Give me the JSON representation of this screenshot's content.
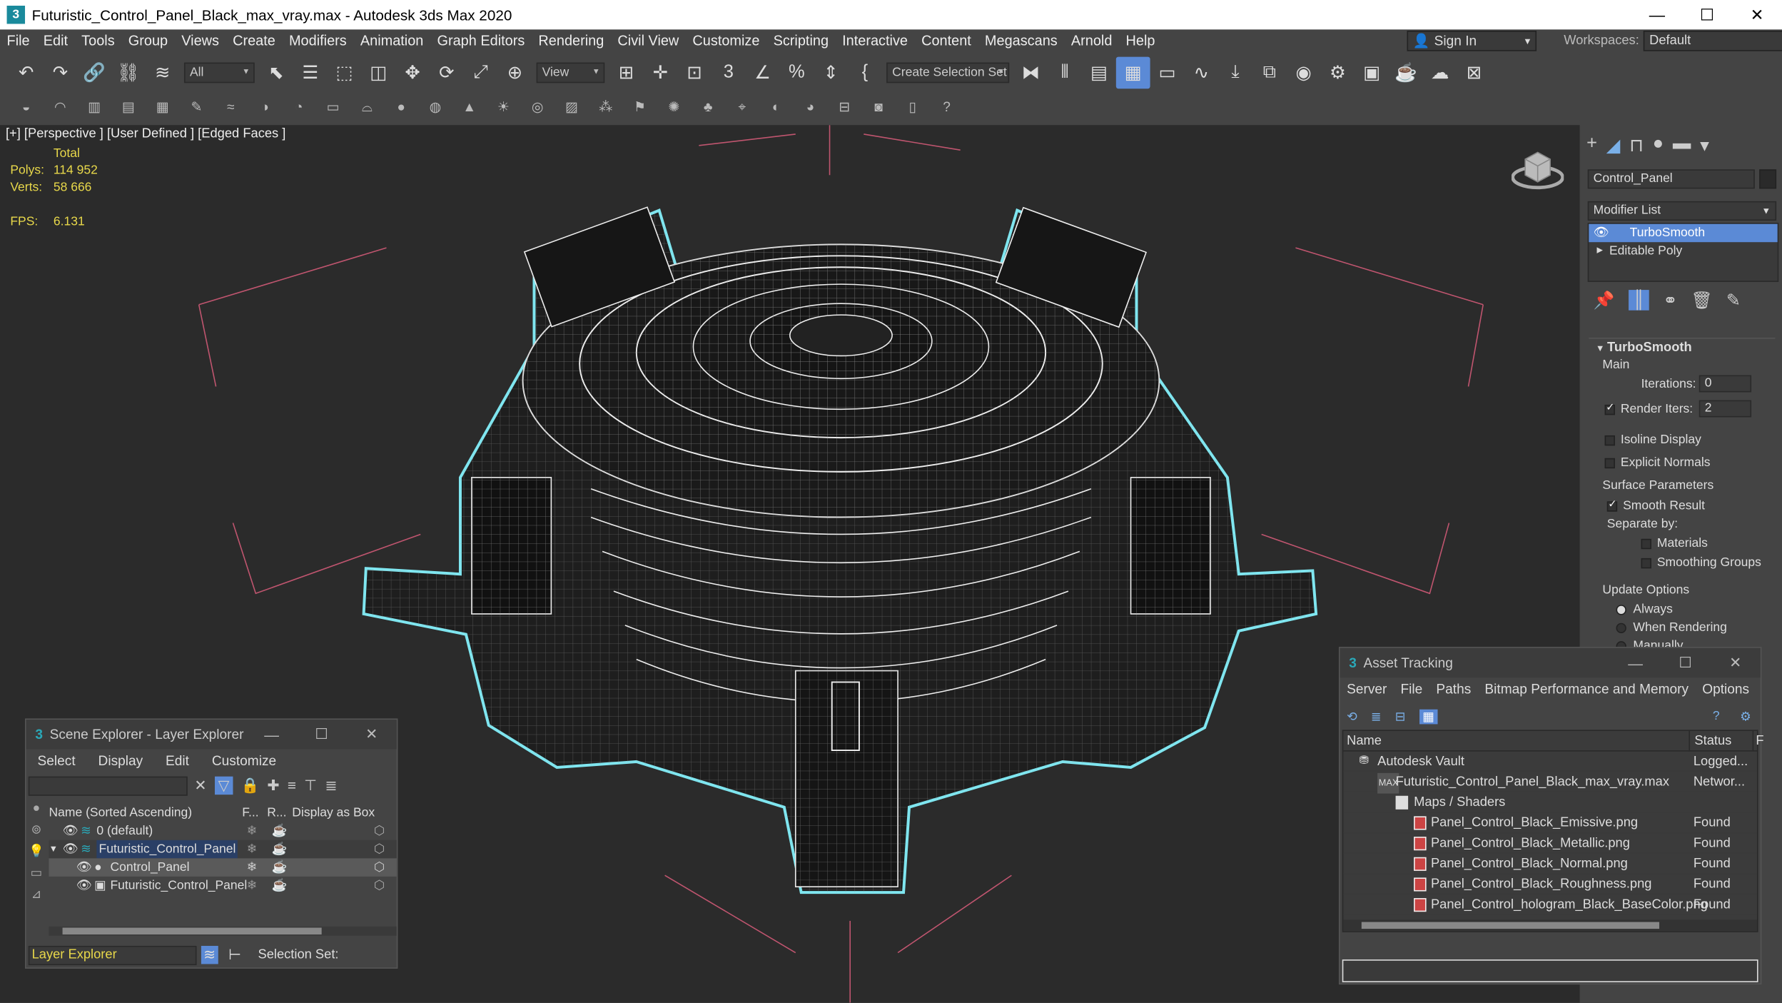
{
  "window": {
    "title": "Futuristic_Control_Panel_Black_max_vray.max - Autodesk 3ds Max 2020",
    "app_icon": "3",
    "minimize": "—",
    "maximize": "☐",
    "close": "✕"
  },
  "menubar": [
    "File",
    "Edit",
    "Tools",
    "Group",
    "Views",
    "Create",
    "Modifiers",
    "Animation",
    "Graph Editors",
    "Rendering",
    "Civil View",
    "Customize",
    "Scripting",
    "Interactive",
    "Content",
    "Megascans",
    "Arnold",
    "Help"
  ],
  "signin": {
    "label": "Sign In"
  },
  "workspaces": {
    "label": "Workspaces:",
    "value": "Default"
  },
  "toolbar": {
    "filter_dropdown": "All",
    "refcoord_dropdown": "View",
    "selection_set": "Create Selection Set"
  },
  "viewport": {
    "label": "[+] [Perspective ] [User Defined ] [Edged Faces ]",
    "stats_total": "Total",
    "polys_label": "Polys:",
    "polys_value": "114 952",
    "verts_label": "Verts:",
    "verts_value": "58 666",
    "fps_label": "FPS:",
    "fps_value": "6.131"
  },
  "command_panel": {
    "object_name": "Control_Panel",
    "modifier_list": "Modifier List",
    "stack": [
      "TurboSmooth",
      "Editable Poly"
    ],
    "rollout_title": "TurboSmooth",
    "main": "Main",
    "iterations_label": "Iterations:",
    "iterations_value": "0",
    "render_iters_label": "Render Iters:",
    "render_iters_value": "2",
    "isoline": "Isoline Display",
    "explicit_normals": "Explicit Normals",
    "surface_params": "Surface Parameters",
    "smooth_result": "Smooth Result",
    "separate_by": "Separate by:",
    "materials": "Materials",
    "smoothing_groups": "Smoothing Groups",
    "update_options": "Update Options",
    "always": "Always",
    "when_rendering": "When Rendering",
    "manually": "Manually"
  },
  "scene_explorer": {
    "title": "Scene Explorer - Layer Explorer",
    "menu": [
      "Select",
      "Display",
      "Edit",
      "Customize"
    ],
    "col_name": "Name (Sorted Ascending)",
    "col_f": "F...",
    "col_r": "R...",
    "col_box": "Display as Box",
    "rows": [
      "0 (default)",
      "Futuristic_Control_Panel",
      "Control_Panel",
      "Futuristic_Control_Panel"
    ],
    "footer_dropdown": "Layer Explorer",
    "selection_set": "Selection Set:"
  },
  "asset_tracking": {
    "title": "Asset Tracking",
    "menu": [
      "Server",
      "File",
      "Paths",
      "Bitmap Performance and Memory",
      "Options"
    ],
    "col_name": "Name",
    "col_status": "Status",
    "col_f": "F",
    "rows": [
      {
        "name": "Autodesk Vault",
        "status": "Logged..."
      },
      {
        "name": "Futuristic_Control_Panel_Black_max_vray.max",
        "status": "Networ..."
      },
      {
        "name": "Maps / Shaders",
        "status": ""
      },
      {
        "name": "Panel_Control_Black_Emissive.png",
        "status": "Found"
      },
      {
        "name": "Panel_Control_Black_Metallic.png",
        "status": "Found"
      },
      {
        "name": "Panel_Control_Black_Normal.png",
        "status": "Found"
      },
      {
        "name": "Panel_Control_Black_Roughness.png",
        "status": "Found"
      },
      {
        "name": "Panel_Control_hologram_Black_BaseColor.png",
        "status": "Found"
      }
    ]
  },
  "colors": {
    "selection_outline": "#7fe6f0",
    "stats_yellow": "#e8d84a",
    "highlight_blue": "#5b8ad6"
  }
}
